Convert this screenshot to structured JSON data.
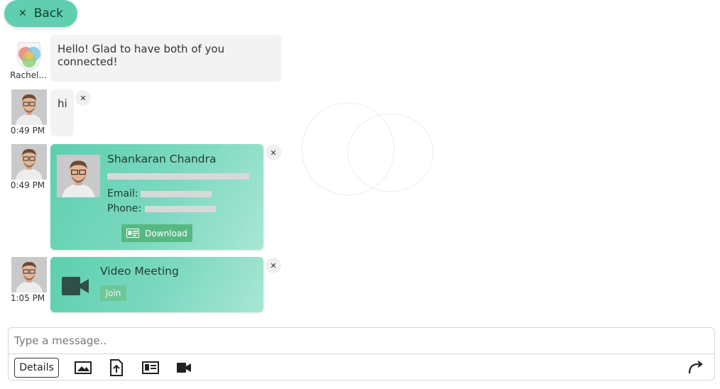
{
  "header": {
    "back_label": "Back"
  },
  "messages": [
    {
      "sender": "Rachel...",
      "text": "Hello! Glad to have both of you connected!"
    },
    {
      "time": "0:49 PM",
      "text": "hi"
    },
    {
      "time": "0:49 PM",
      "contact_card": {
        "name": "Shankaran Chandra",
        "email_label": "Email:",
        "phone_label": "Phone:",
        "download_label": "Download"
      }
    },
    {
      "time": "1:05 PM",
      "meeting_card": {
        "title": "Video Meeting",
        "join_label": "Join"
      }
    }
  ],
  "composer": {
    "placeholder": "Type a message..",
    "details_label": "Details",
    "tools": [
      "image-icon",
      "upload-icon",
      "contact-card-icon",
      "video-camera-icon",
      "redo-icon"
    ]
  },
  "colors": {
    "accent": "#5fcfb0",
    "card_gradient_start": "#5ccfaf",
    "card_gradient_end": "#a9e6d5",
    "download_button": "#56b882",
    "bubble": "#f3f3f3"
  }
}
